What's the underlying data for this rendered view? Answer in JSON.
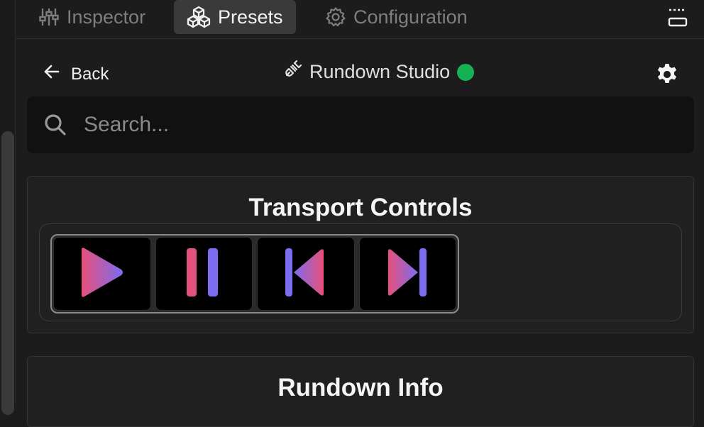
{
  "tabs": [
    {
      "label": "Inspector",
      "icon": "sliders-icon",
      "active": false
    },
    {
      "label": "Presets",
      "icon": "cubes-icon",
      "active": true
    },
    {
      "label": "Configuration",
      "icon": "gear-icon",
      "active": false
    }
  ],
  "header": {
    "back_label": "Back",
    "connection_name": "Rundown Studio",
    "connection_status_color": "#17b155"
  },
  "search": {
    "placeholder": "Search..."
  },
  "sections": [
    {
      "title": "Transport Controls",
      "buttons": [
        {
          "icon": "play-icon"
        },
        {
          "icon": "pause-icon"
        },
        {
          "icon": "skip-previous-icon"
        },
        {
          "icon": "skip-next-icon"
        }
      ]
    },
    {
      "title": "Rundown Info"
    }
  ],
  "colors": {
    "gradient_pink": "#e8507a",
    "gradient_purple": "#7b6cf0",
    "active_tab_bg": "#3a3a3a",
    "panel_bg": "#1c1c1c"
  }
}
